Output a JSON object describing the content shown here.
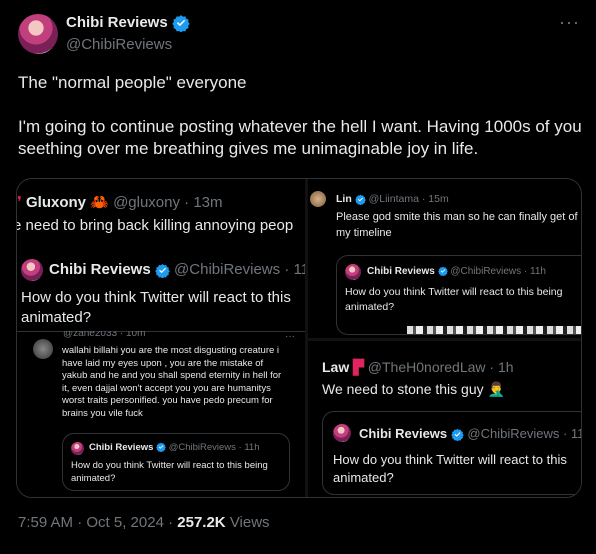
{
  "author": {
    "name": "Chibi Reviews",
    "handle": "@ChibiReviews"
  },
  "more_icon": "···",
  "tweet": {
    "text": "The \"normal people\" everyone\n\nI'm going to continue posting whatever the hell I want. Having 1000s of you seething over me breathing gives me unimaginable joy in life."
  },
  "media": {
    "left": {
      "top_tweet": {
        "name": "Gluxony",
        "emoji": "🦀",
        "handle": "@gluxony",
        "time": "· 13m",
        "text": "e need to bring back killing annoying peop"
      },
      "main_tweet": {
        "name": "Chibi Reviews",
        "handle": "@ChibiReviews",
        "time": "· 11",
        "text_line1": "How do you think Twitter will react to this",
        "text_line2": "animated?"
      },
      "reply": {
        "header": "@zane2033 · 10m",
        "lines": [
          "wallahi billahi you are the most disgusting creature i",
          "have laid my eyes upon , you are the mistake of",
          "yakub and he and you shall spend eternity in hell for",
          "it, even dajjal won't accept you you are humanitys",
          "worst traits personified. you have pedo precum for",
          "brains you vile fuck"
        ],
        "more": "···",
        "quote": {
          "name": "Chibi Reviews",
          "handle": "@ChibiReviews",
          "time": "· 11h",
          "text_line1": "How do you think Twitter will react to this being",
          "text_line2": "animated?"
        }
      }
    },
    "top_right": {
      "name": "Lin",
      "handle": "@Liintama",
      "time": "· 15m",
      "text_line1": "Please god smite this man so he can finally get of",
      "text_line2": "my timeline",
      "quote": {
        "name": "Chibi Reviews",
        "handle": "@ChibiReviews",
        "time": "· 11h",
        "text_line1": "How do you think Twitter will react to this being",
        "text_line2": "animated?"
      }
    },
    "bottom_right": {
      "name": "Law",
      "handle": "@TheH0noredLaw",
      "time": "· 1h",
      "text": "We need to stone this guy",
      "emoji": "🤦‍♂️",
      "quote": {
        "name": "Chibi Reviews",
        "handle": "@ChibiReviews",
        "time": "· 11",
        "text_line1": "How do you think Twitter will react to this",
        "text_line2": "animated?"
      }
    }
  },
  "footer": {
    "time": "7:59 AM · Oct 5, 2024",
    "separator": "·",
    "views_count": "257.2K",
    "views_label": "Views"
  },
  "colors": {
    "background": "#000000",
    "text": "#e7e9ea",
    "muted": "#71767b",
    "verified": "#1d9bf0",
    "border": "#2f3336"
  }
}
